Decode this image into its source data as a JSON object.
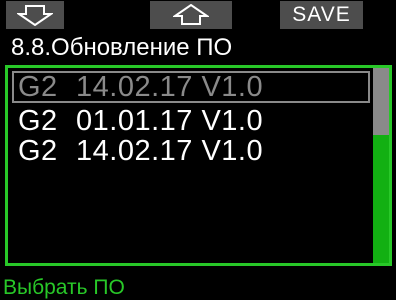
{
  "softkeys": {
    "left_icon": "arrow-down-icon",
    "middle_icon": "arrow-up-icon",
    "right_label": "SAVE"
  },
  "screen": {
    "title": "8.8.Обновление ПО"
  },
  "firmware_list": {
    "selected_index": 0,
    "items": [
      {
        "model": "G2",
        "version": "14.02.17 V1.0"
      },
      {
        "model": "G2",
        "version": "01.01.17 V1.0"
      },
      {
        "model": "G2",
        "version": "14.02.17 V1.0"
      }
    ]
  },
  "footer": {
    "hint": "Выбрать ПО"
  },
  "colors": {
    "accent_green": "#28c828",
    "selection_gray": "#8a8a8a",
    "softkey_bg": "#4d4d4d",
    "background": "#000000"
  }
}
